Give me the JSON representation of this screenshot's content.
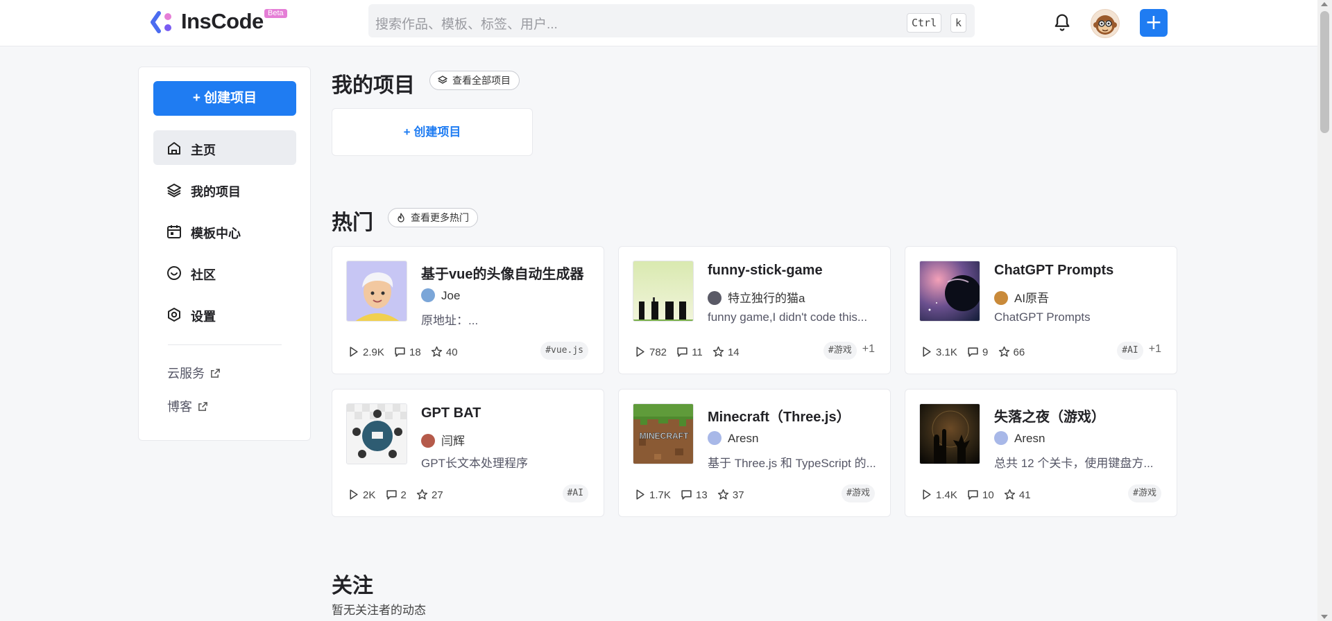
{
  "header": {
    "logo_text": "InsCode",
    "beta": "Beta",
    "search_placeholder": "搜索作品、模板、标签、用户...",
    "shortcut_ctrl": "Ctrl",
    "shortcut_k": "k",
    "add_label": "+"
  },
  "sidebar": {
    "create_label": "+ 创建项目",
    "items": [
      {
        "label": "主页",
        "icon": "home-icon"
      },
      {
        "label": "我的项目",
        "icon": "layers-icon"
      },
      {
        "label": "模板中心",
        "icon": "template-icon"
      },
      {
        "label": "社区",
        "icon": "community-icon"
      },
      {
        "label": "设置",
        "icon": "settings-icon"
      }
    ],
    "links": [
      {
        "label": "云服务"
      },
      {
        "label": "博客"
      }
    ]
  },
  "my_projects": {
    "title": "我的项目",
    "view_all": "查看全部项目",
    "create_label": "+ 创建项目"
  },
  "hot": {
    "title": "热门",
    "view_more": "查看更多热门",
    "cards": [
      {
        "title": "基于vue的头像自动生成器",
        "author": "Joe",
        "desc": "原地址：...",
        "views": "2.9K",
        "comments": "18",
        "stars": "40",
        "tags": [
          "#vue.js"
        ],
        "more": ""
      },
      {
        "title": "funny-stick-game",
        "author": "特立独行的猫a",
        "desc": "funny game,I didn't code this...",
        "views": "782",
        "comments": "11",
        "stars": "14",
        "tags": [
          "#游戏"
        ],
        "more": "+1"
      },
      {
        "title": "ChatGPT Prompts",
        "author": "AI原吾",
        "desc": "ChatGPT Prompts",
        "views": "3.1K",
        "comments": "9",
        "stars": "66",
        "tags": [
          "#AI"
        ],
        "more": "+1"
      },
      {
        "title": "GPT BAT",
        "author": "闫辉",
        "desc": "GPT长文本处理程序",
        "views": "2K",
        "comments": "2",
        "stars": "27",
        "tags": [
          "#AI"
        ],
        "more": ""
      },
      {
        "title": "Minecraft（Three.js）",
        "author": "Aresn",
        "desc": "基于 Three.js 和 TypeScript 的...",
        "views": "1.7K",
        "comments": "13",
        "stars": "37",
        "tags": [
          "#游戏"
        ],
        "more": ""
      },
      {
        "title": "失落之夜（游戏）",
        "author": "Aresn",
        "desc": "总共 12 个关卡，使用键盘方...",
        "views": "1.4K",
        "comments": "10",
        "stars": "41",
        "tags": [
          "#游戏"
        ],
        "more": ""
      }
    ]
  },
  "follow": {
    "title": "关注",
    "empty": "暂无关注者的动态"
  },
  "colors": {
    "accent": "#1f7cf2",
    "beta": "#e57ed6",
    "background": "#f6f7f9"
  }
}
